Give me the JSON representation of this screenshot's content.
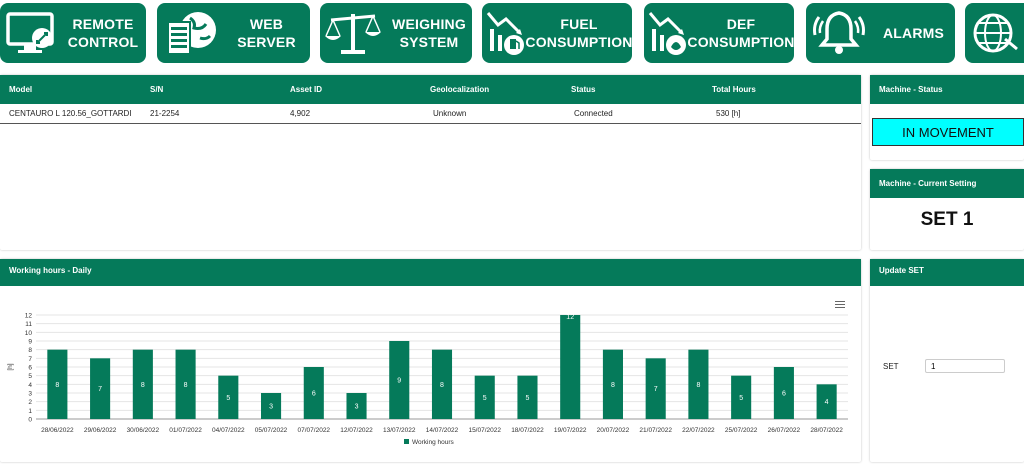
{
  "nav": {
    "remote_control": "REMOTE\nCONTROL",
    "web_server": "WEB\nSERVER",
    "weighing_system": "WEIGHING\nSYSTEM",
    "fuel_consumption": "FUEL\nCONSUMPTION",
    "def_consumption": "DEF\nCONSUMPTION",
    "alarms": "ALARMS"
  },
  "machine_table": {
    "headers": {
      "model": "Model",
      "sn": "S/N",
      "asset_id": "Asset ID",
      "geolocalization": "Geolocalization",
      "status": "Status",
      "total_hours": "Total Hours"
    },
    "row": {
      "model": "CENTAURO L 120.56_GOTTARDI",
      "sn": "21-2254",
      "asset_id": "4,902",
      "geolocalization": "Unknown",
      "status": "Connected",
      "total_hours": "530 [h]"
    }
  },
  "machine_status": {
    "title": "Machine - Status",
    "value": "IN MOVEMENT"
  },
  "current_setting": {
    "title": "Machine - Current Setting",
    "value": "SET 1"
  },
  "update_set": {
    "title": "Update SET",
    "label": "SET",
    "input_value": "1"
  },
  "working_hours": {
    "title": "Working hours - Daily"
  },
  "colors": {
    "brand_green": "#057a5a",
    "status_cyan": "#00ffff"
  },
  "chart_data": {
    "type": "bar",
    "categories": [
      "28/06/2022",
      "29/06/2022",
      "30/06/2022",
      "01/07/2022",
      "04/07/2022",
      "05/07/2022",
      "07/07/2022",
      "12/07/2022",
      "13/07/2022",
      "14/07/2022",
      "15/07/2022",
      "18/07/2022",
      "19/07/2022",
      "20/07/2022",
      "21/07/2022",
      "22/07/2022",
      "25/07/2022",
      "26/07/2022",
      "28/07/2022"
    ],
    "series": [
      {
        "name": "Working hours",
        "values": [
          8,
          7,
          8,
          8,
          5,
          3,
          6,
          3,
          9,
          8,
          5,
          5,
          12,
          8,
          7,
          8,
          5,
          6,
          4
        ]
      }
    ],
    "ylabel": "[h]",
    "ylim": [
      0,
      12
    ],
    "yticks": [
      0,
      1,
      2,
      3,
      4,
      5,
      6,
      7,
      8,
      9,
      10,
      11,
      12
    ],
    "grid": true,
    "legend": "bottom",
    "bar_color": "#057a5a"
  }
}
